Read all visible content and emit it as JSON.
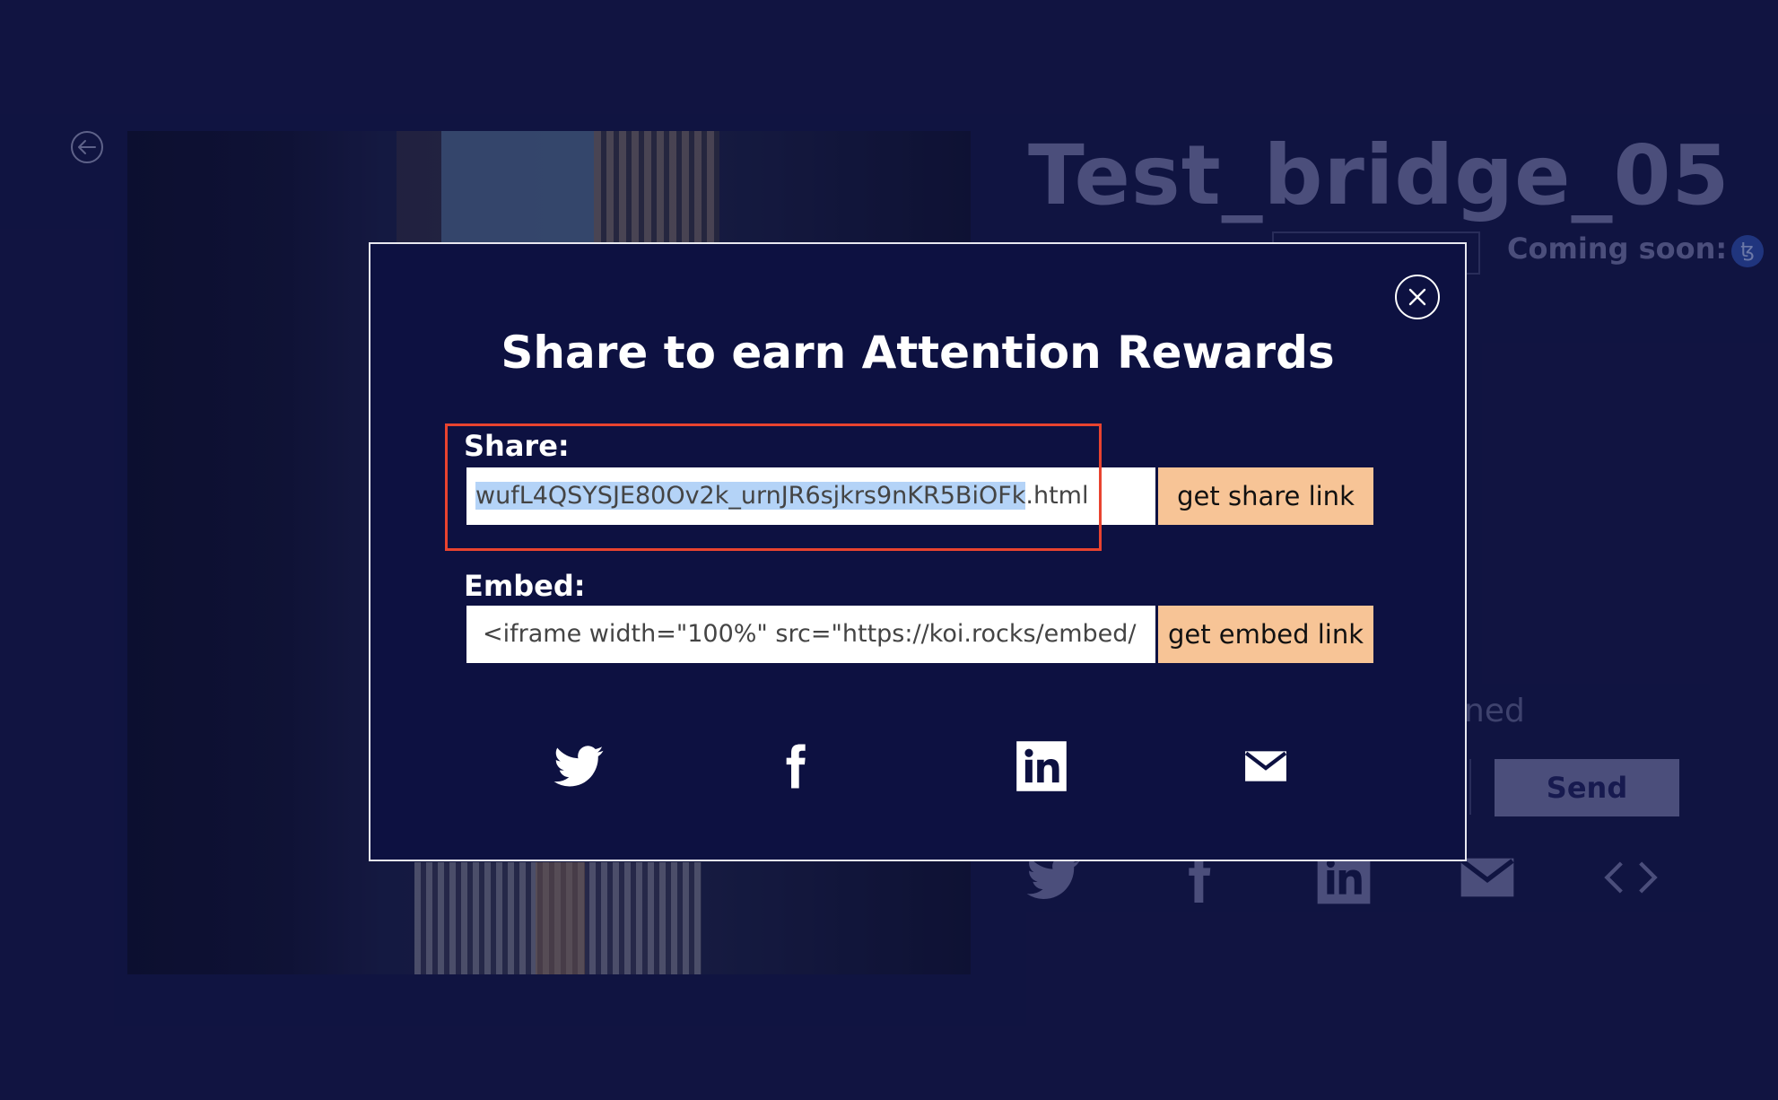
{
  "page": {
    "asset_title": "Test_bridge_05",
    "coming_soon_label": "Coming soon:",
    "coming_soon_icon": "tezos-icon",
    "faded_text": "ned",
    "send_label": "Send",
    "background_social_icons": [
      "twitter-icon",
      "facebook-icon",
      "linkedin-icon",
      "email-icon",
      "embed-code-icon"
    ]
  },
  "modal": {
    "title": "Share to earn Attention Rewards",
    "share": {
      "label": "Share:",
      "value_visible": "wufL4QSYSJE80Ov2k_urnJR6sjkrs9nKR5BiOFk",
      "value_suffix": ".html",
      "button_label": "get share link"
    },
    "embed": {
      "label": "Embed:",
      "value": "<iframe width=\"100%\" src=\"https://koi.rocks/embed/",
      "button_label": "get embed link"
    },
    "social_icons": [
      "twitter-icon",
      "facebook-icon",
      "linkedin-icon",
      "email-icon"
    ]
  },
  "colors": {
    "background": "#13174a",
    "modal_background": "#0d1141",
    "accent_button": "#f7c496",
    "highlight": "#e8432f",
    "selection": "#b4d3f7"
  }
}
